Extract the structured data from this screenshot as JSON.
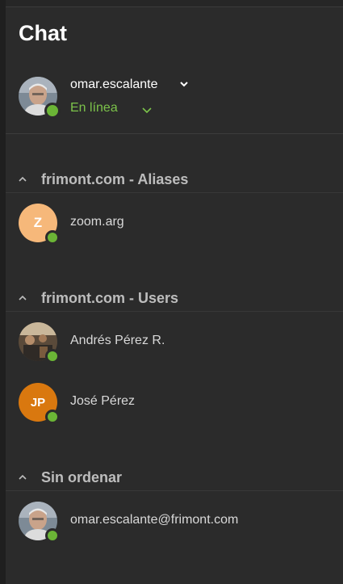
{
  "header": {
    "title": "Chat"
  },
  "me": {
    "username": "omar.escalante",
    "status": "En línea"
  },
  "groups": [
    {
      "title": "frimont.com - Aliases",
      "contacts": [
        {
          "name": "zoom.arg",
          "initials": "Z"
        }
      ]
    },
    {
      "title": "frimont.com - Users",
      "contacts": [
        {
          "name": "Andrés Pérez R.",
          "initials": ""
        },
        {
          "name": "José Pérez",
          "initials": "JP"
        }
      ]
    },
    {
      "title": "Sin ordenar",
      "contacts": [
        {
          "name": "omar.escalante@frimont.com",
          "initials": ""
        }
      ]
    }
  ],
  "colors": {
    "background": "#2b2b2b",
    "online": "#6bb536",
    "status_text": "#7cc34a",
    "avatar_z": "#f6b87a",
    "avatar_jp": "#d9780f"
  },
  "icons": {
    "presence": "online-dot-icon",
    "chevron": "chevron-down-icon",
    "collapse": "chevron-up-icon"
  }
}
